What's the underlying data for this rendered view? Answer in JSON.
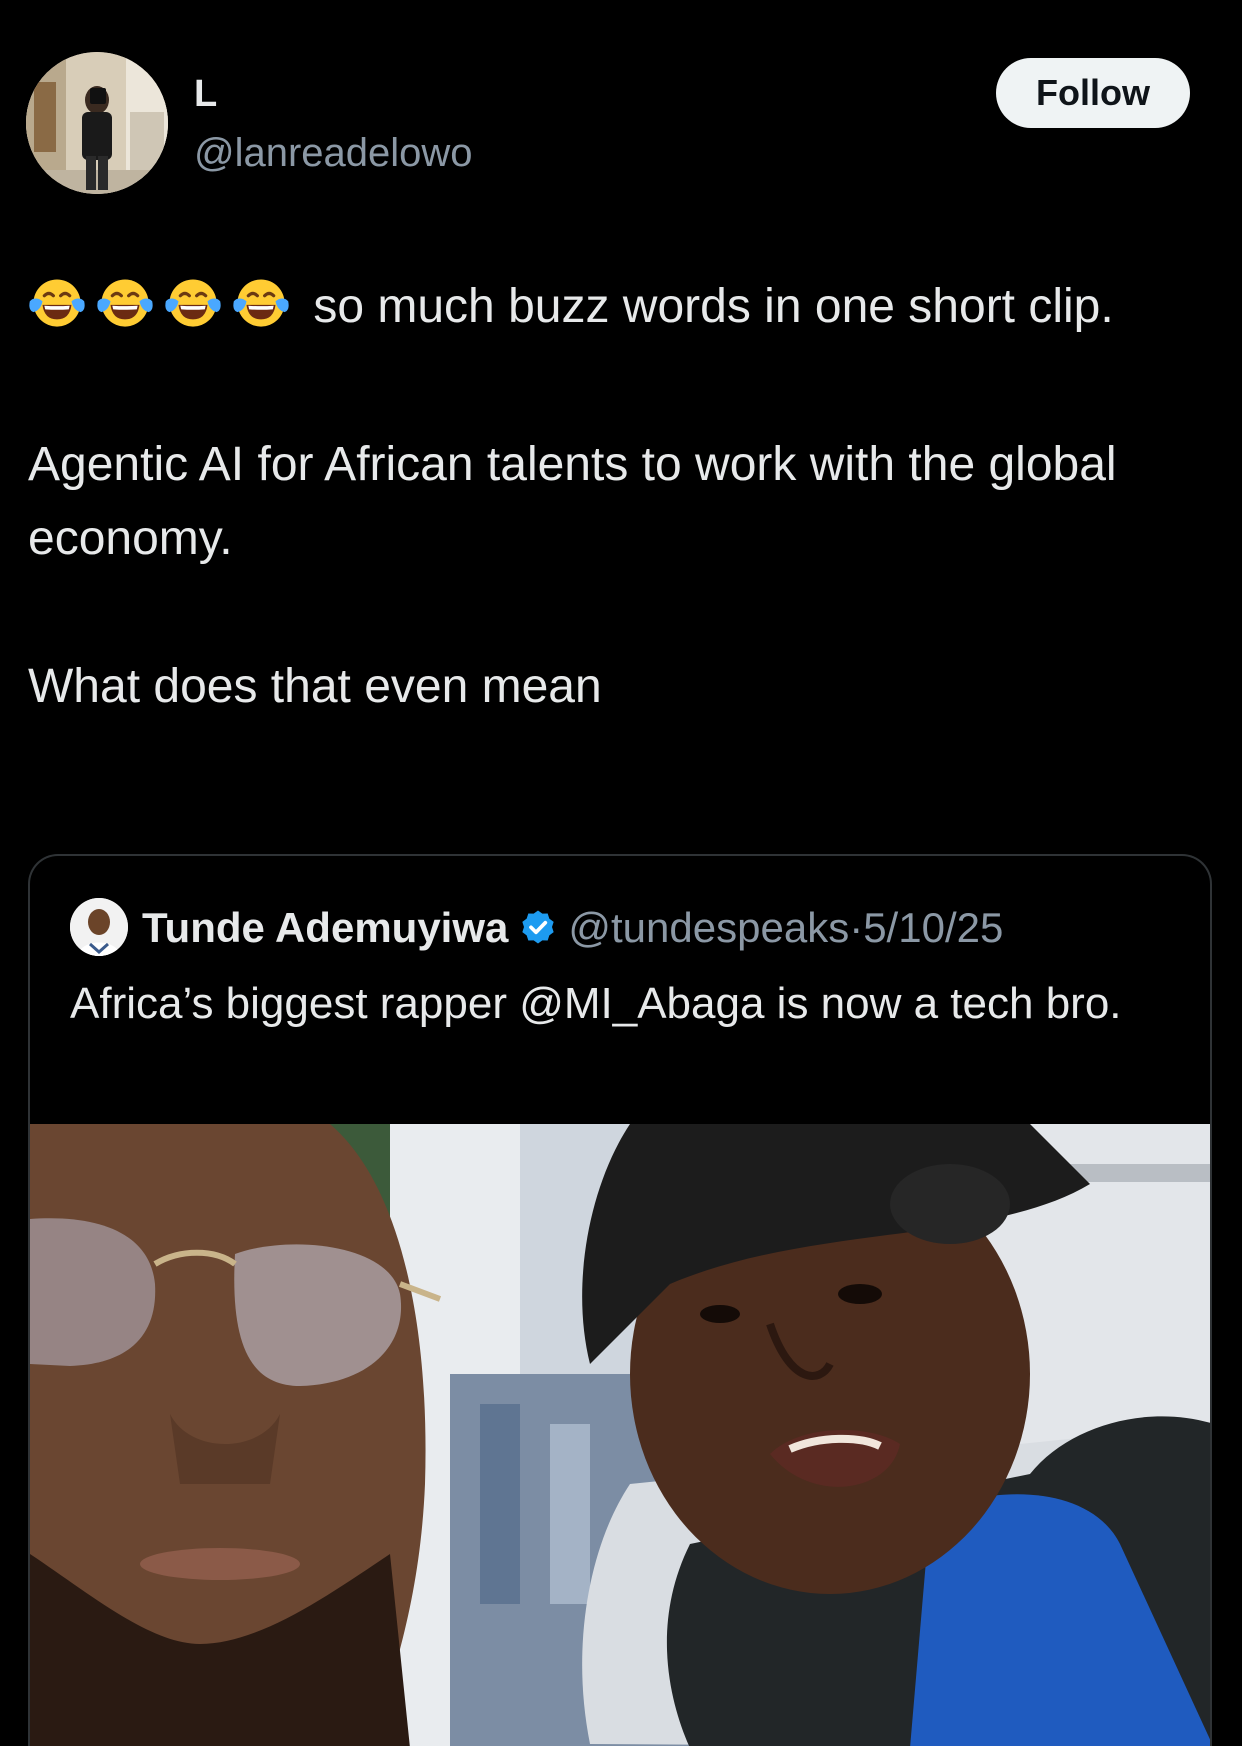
{
  "tweet": {
    "author": {
      "display_name": "L",
      "handle": "@lanreadelowo"
    },
    "follow_label": "Follow",
    "emoji": [
      "face-with-tears-of-joy",
      "face-with-tears-of-joy",
      "face-with-tears-of-joy",
      "face-with-tears-of-joy"
    ],
    "line1_text": " so much buzz words in one short clip.",
    "paragraph2": "Agentic AI for African talents to work with the global economy.",
    "paragraph3": "What does that even mean"
  },
  "quoted_tweet": {
    "display_name": "Tunde Ademuyiwa",
    "verified_icon": "verified-badge-icon",
    "handle": "@tundespeaks",
    "separator": "·",
    "date": "5/10/25",
    "text": "Africa’s biggest rapper @MI_Abaga is now a tech bro."
  },
  "colors": {
    "background": "#000000",
    "text_primary": "#e7e9ea",
    "text_secondary": "#8b98a5",
    "follow_button_bg": "#eff3f4",
    "verified_blue": "#1d9bf0",
    "card_border": "#2f3336"
  }
}
